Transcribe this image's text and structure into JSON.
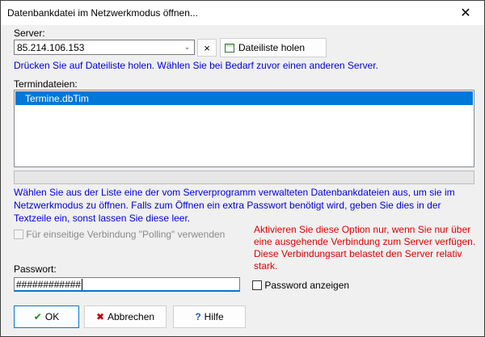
{
  "window": {
    "title": "Datenbankdatei im Netzwerkmodus öffnen..."
  },
  "server": {
    "label": "Server:",
    "value": "85.214.106.153",
    "clear_label": "×",
    "fetch_button_label": "Dateiliste holen",
    "hint": "Drücken Sie auf Dateiliste holen.  Wählen Sie bei Bedarf zuvor einen anderen Server."
  },
  "files": {
    "label": "Termindateien:",
    "items": [
      "Termine.dbTim"
    ],
    "selected_index": 0
  },
  "description": [
    "Wählen Sie aus der Liste eine der vom Serverprogramm verwalteten Datenbankdateien aus, um sie im",
    "Netzwerkmodus zu öffnen. Falls zum Öffnen ein extra Passwort benötigt wird, geben Sie dies in der",
    "Textzeile ein, sonst lassen Sie diese leer."
  ],
  "polling": {
    "label": "Für einseitige Verbindung \"Polling\" verwenden",
    "checked": false,
    "enabled": false,
    "warning": [
      "Aktivieren Sie diese Option nur, wenn  Sie nur über",
      "eine ausgehende Verbindung zum Server verfügen.",
      "Diese Verbindungsart belastet den Server relativ",
      "stark."
    ]
  },
  "password": {
    "label": "Passwort:",
    "value": "############",
    "show_label": "Password anzeigen",
    "show_checked": false
  },
  "buttons": {
    "ok": "OK",
    "cancel": "Abbrechen",
    "help": "Hilfe"
  },
  "colors": {
    "hint": "#0000e0",
    "warning": "#e00000",
    "selection": "#0078d7"
  }
}
